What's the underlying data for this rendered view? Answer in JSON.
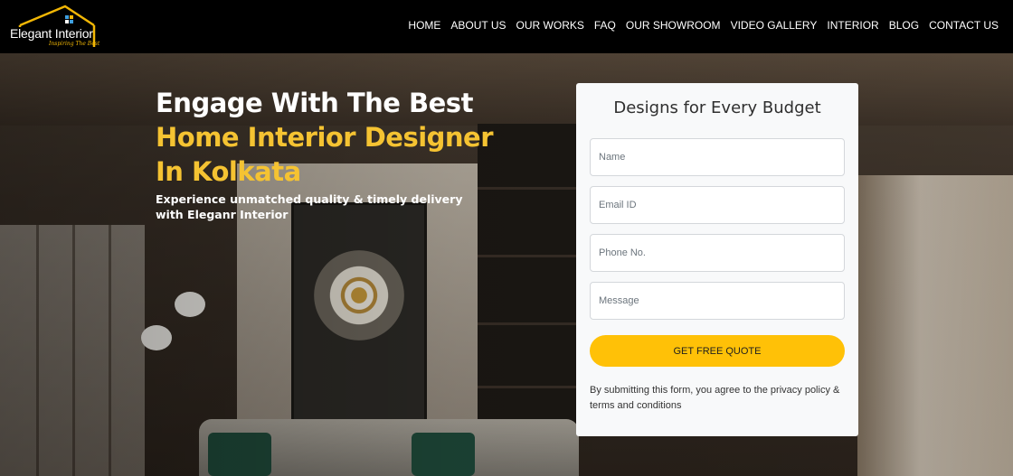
{
  "brand": {
    "name": "Elegant Interior",
    "tagline": "Inspiring The Best",
    "colors": {
      "accent": "#ffc107",
      "headline_highlight": "#f5c332",
      "header_bg": "#000000"
    }
  },
  "nav": {
    "items": [
      {
        "label": "HOME"
      },
      {
        "label": "ABOUT US"
      },
      {
        "label": "OUR WORKS"
      },
      {
        "label": "FAQ"
      },
      {
        "label": "OUR SHOWROOM"
      },
      {
        "label": "VIDEO GALLERY"
      },
      {
        "label": "INTERIOR"
      },
      {
        "label": "BLOG"
      },
      {
        "label": "CONTACT US"
      }
    ]
  },
  "hero": {
    "line1": "Engage With The Best",
    "line2": "Home Interior Designer",
    "line3": "In Kolkata",
    "subtitle": "Experience unmatched quality & timely delivery with Eleganr Interior"
  },
  "form": {
    "title": "Designs for Every Budget",
    "fields": {
      "name": {
        "placeholder": "Name",
        "value": ""
      },
      "email": {
        "placeholder": "Email ID",
        "value": ""
      },
      "phone": {
        "placeholder": "Phone No.",
        "value": ""
      },
      "message": {
        "placeholder": "Message",
        "value": ""
      }
    },
    "submit_label": "GET FREE QUOTE",
    "disclaimer": "By submitting this form, you agree to the privacy policy & terms and conditions"
  }
}
